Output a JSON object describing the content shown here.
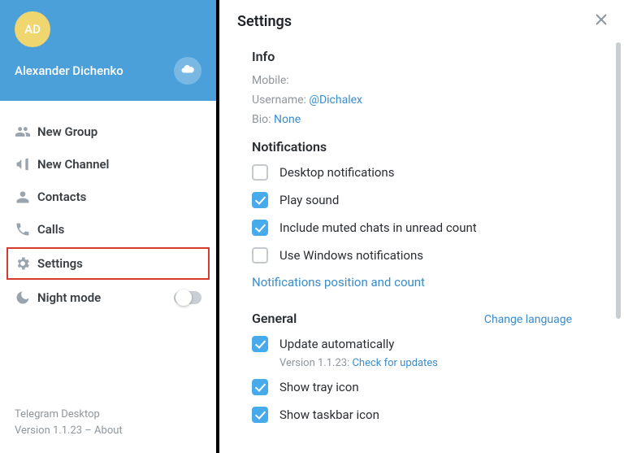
{
  "profile": {
    "initials": "AD",
    "name": "Alexander Dichenko"
  },
  "menu": {
    "new_group": "New Group",
    "new_channel": "New Channel",
    "contacts": "Contacts",
    "calls": "Calls",
    "settings": "Settings",
    "night_mode": "Night mode"
  },
  "footer": {
    "app": "Telegram Desktop",
    "version_prefix": "Version 1.1.23 – ",
    "about": "About"
  },
  "panel": {
    "title": "Settings"
  },
  "info": {
    "heading": "Info",
    "mobile_label": "Mobile:",
    "username_label": "Username: ",
    "username_value": "@Dichalex",
    "bio_label": "Bio: ",
    "bio_value": "None"
  },
  "notifications": {
    "heading": "Notifications",
    "desktop": "Desktop notifications",
    "play_sound": "Play sound",
    "include_muted": "Include muted chats in unread count",
    "use_windows": "Use Windows notifications",
    "position_link": "Notifications position and count"
  },
  "general": {
    "heading": "General",
    "change_language": "Change language",
    "update_auto": "Update automatically",
    "update_sub_prefix": "Version 1.1.23: ",
    "update_sub_link": "Check for updates",
    "show_tray": "Show tray icon",
    "show_taskbar": "Show taskbar icon"
  }
}
